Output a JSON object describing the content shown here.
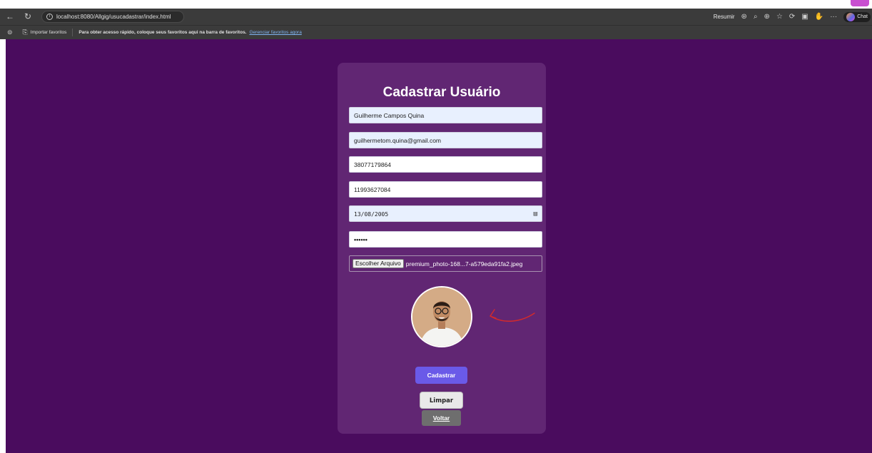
{
  "browser": {
    "url": "localhost:8080/Allgig/usucadastrar/index.html",
    "resumir_label": "Resumir",
    "chat_label": "Chat",
    "icons": [
      "back-icon",
      "refresh-icon",
      "info-icon",
      "translate-icon",
      "read-aloud-icon",
      "zoom-icon",
      "favorite-star-icon",
      "extensions-icon",
      "split-screen-icon",
      "profile-icon",
      "more-icon",
      "copilot-icon"
    ]
  },
  "favorites_bar": {
    "import_label": "Importar favoritos",
    "message": "Para obter acesso rápido, coloque seus favoritos aqui na barra de favoritos.",
    "manage_link": "Gerenciar favoritos agora"
  },
  "form": {
    "title": "Cadastrar Usuário",
    "name_value": "Guilherme Campos Quina",
    "email_value": "guilhermetom.quina@gmail.com",
    "cpf_value": "38077179864",
    "phone_value": "11993627084",
    "birthdate_value": "13/08/2005",
    "password_value": "••••••",
    "file_button_label": "Escolher Arquivo",
    "file_name": "premium_photo-168...7-a579eda91fa2.jpeg",
    "submit_label": "Cadastrar",
    "clear_label": "Limpar",
    "back_label": "Voltar"
  },
  "colors": {
    "page_background": "#4a0c5e",
    "card_background": "#612673",
    "submit_button": "#6a5ae8",
    "back_button": "#6e6e6e",
    "arrow": "#d42a2a"
  }
}
